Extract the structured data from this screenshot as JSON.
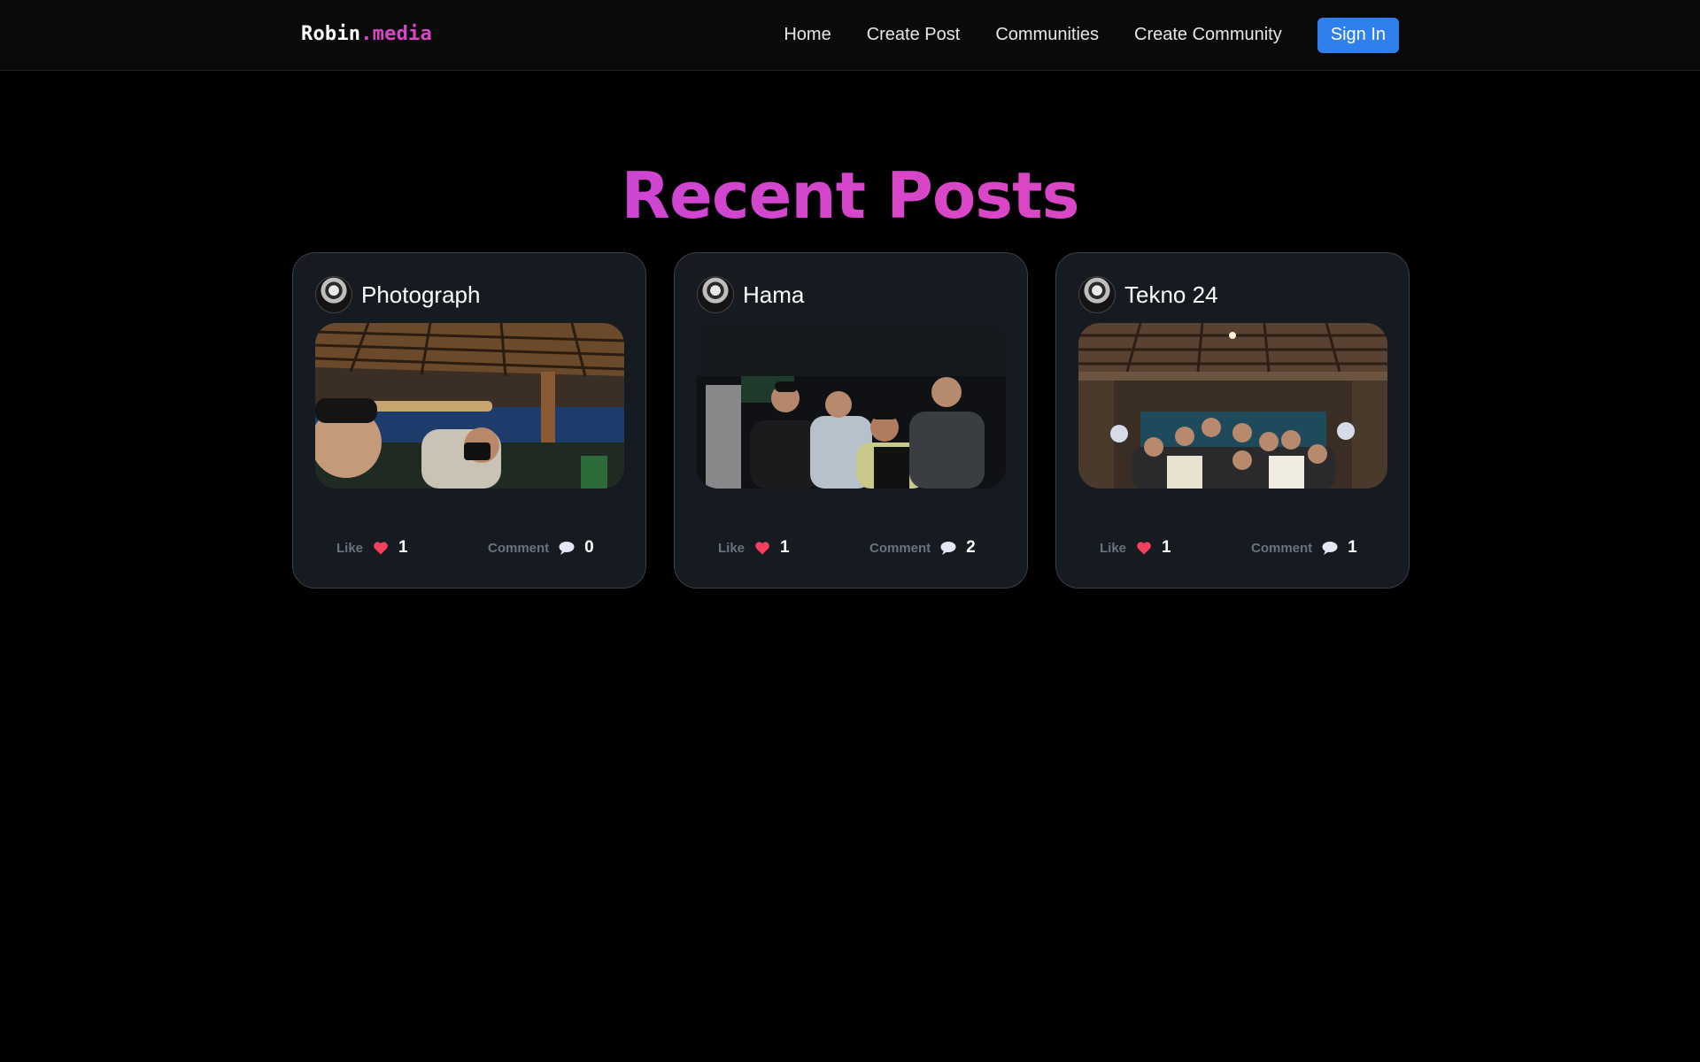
{
  "brand": {
    "name": "Robin",
    "suffix": ".media"
  },
  "nav": {
    "links": [
      "Home",
      "Create Post",
      "Communities",
      "Create Community"
    ],
    "signin": "Sign In"
  },
  "heading": "Recent Posts",
  "posts": [
    {
      "title": "Photograph",
      "like_label": "Like",
      "likes": "1",
      "comment_label": "Comment",
      "comments": "0"
    },
    {
      "title": "Hama",
      "like_label": "Like",
      "likes": "1",
      "comment_label": "Comment",
      "comments": "2"
    },
    {
      "title": "Tekno 24",
      "like_label": "Like",
      "likes": "1",
      "comment_label": "Comment",
      "comments": "1"
    }
  ],
  "colors": {
    "accent": "#d946c8",
    "signin_bg": "#2f80ed",
    "card_bg": "#161a21",
    "like_heart": "#f43f5e"
  },
  "icons": {
    "like": "heart-icon",
    "comment": "speech-bubble-icon"
  }
}
